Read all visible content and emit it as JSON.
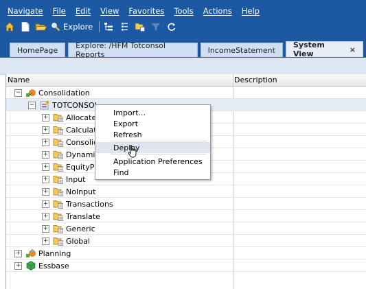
{
  "menubar": {
    "items": [
      "Navigate",
      "File",
      "Edit",
      "View",
      "Favorites",
      "Tools",
      "Actions",
      "Help"
    ]
  },
  "toolbar": {
    "explore_label": "Explore"
  },
  "tabs": [
    {
      "label": "HomePage"
    },
    {
      "label": "Explore: /HFM Totconsol Reports"
    },
    {
      "label": "IncomeStatement"
    },
    {
      "label": "System View",
      "close": "×"
    }
  ],
  "grid": {
    "columns": [
      "Name",
      "Description"
    ],
    "rows": [
      {
        "label": "Consolidation",
        "toggle": "−",
        "icon": "consolidation-app-icon"
      },
      {
        "label": "TOTCONSOL",
        "toggle": "−",
        "icon": "application-icon"
      },
      {
        "label": "Allocate",
        "toggle": "+",
        "icon": "folder-icon"
      },
      {
        "label": "Calculate",
        "toggle": "+",
        "icon": "folder-icon"
      },
      {
        "label": "Consolida",
        "toggle": "+",
        "icon": "folder-icon"
      },
      {
        "label": "Dynamic",
        "toggle": "+",
        "icon": "folder-icon"
      },
      {
        "label": "EquityPick",
        "toggle": "+",
        "icon": "folder-icon"
      },
      {
        "label": "Input",
        "toggle": "+",
        "icon": "folder-icon"
      },
      {
        "label": "NoInput",
        "toggle": "+",
        "icon": "folder-icon"
      },
      {
        "label": "Transactions",
        "toggle": "+",
        "icon": "folder-icon"
      },
      {
        "label": "Translate",
        "toggle": "+",
        "icon": "folder-icon"
      },
      {
        "label": "Generic",
        "toggle": "+",
        "icon": "folder-icon"
      },
      {
        "label": "Global",
        "toggle": "+",
        "icon": "folder-icon"
      },
      {
        "label": "Planning",
        "toggle": "+",
        "icon": "planning-app-icon"
      },
      {
        "label": "Essbase",
        "toggle": "+",
        "icon": "essbase-app-icon"
      }
    ]
  },
  "context_menu": {
    "items": [
      "Import...",
      "Export",
      "Refresh",
      "Deploy",
      "Application Preferences",
      "Find"
    ],
    "highlighted": "Deploy"
  },
  "colors": {
    "header_bg": "#1d58a3",
    "menu_text": "#ffffff",
    "tab_bg": "#cfe0f3",
    "selected_row": "#e6ecf6",
    "menu_highlight": "#dfe5ee"
  }
}
